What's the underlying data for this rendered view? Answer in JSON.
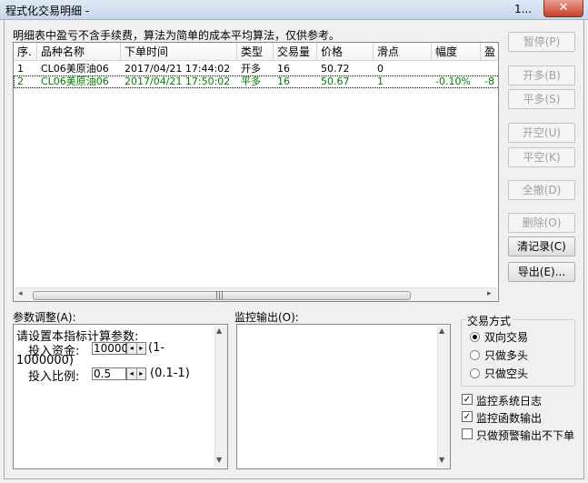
{
  "window": {
    "title": "程式化交易明细 - ",
    "title_suffix": "1...",
    "close": "✕"
  },
  "notice": "明细表中盈亏不含手续费，算法为简单的成本平均算法，仅供参考。",
  "table": {
    "columns": [
      "序.",
      "品种名称",
      "下单时间",
      "类型",
      "交易量",
      "价格",
      "滑点",
      "幅度",
      "盈"
    ],
    "rows": [
      {
        "idx": "1",
        "name": "CL06美原油06",
        "time": "2017/04/21 17:44:02",
        "type": "开多",
        "qty": "16",
        "price": "50.72",
        "slip": "0",
        "range": "",
        "pnl": ""
      },
      {
        "idx": "2",
        "name": "CL06美原油06",
        "time": "2017/04/21 17:50:02",
        "type": "平多",
        "qty": "16",
        "price": "50.67",
        "slip": "1",
        "range": "-0.10%",
        "pnl": "-8"
      }
    ],
    "row_colors": [
      "#000000",
      "#008000"
    ],
    "scroll": {
      "left": "◂",
      "right": "▸",
      "grip": "|||"
    }
  },
  "buttons": {
    "pause": "暂停(P)",
    "open_long": "开多(B)",
    "close_long": "平多(S)",
    "open_short": "开空(U)",
    "close_short": "平空(K)",
    "close_all": "全撤(D)",
    "delete": "删除(O)",
    "clear": "清记录(C)",
    "export": "导出(E)..."
  },
  "params": {
    "label": "参数调整(A):",
    "heading": "请设置本指标计算参数:",
    "fund_label": "投入资金:",
    "fund_value": "10000",
    "fund_range_a": "(1-",
    "fund_range_b": "1000000)",
    "ratio_label": "投入比例:",
    "ratio_value": "0.5",
    "ratio_range": "(0.1-1)",
    "spin_left": "◂",
    "spin_right": "▸",
    "scroll_up": "▲",
    "scroll_down": "▼"
  },
  "monitor": {
    "label": "监控输出(O):"
  },
  "trade_mode": {
    "title": "交易方式",
    "options": [
      "双向交易",
      "只做多头",
      "只做空头"
    ],
    "selected": 0
  },
  "checks": {
    "items": [
      "监控系统日志",
      "监控函数输出",
      "只做预警输出不下单"
    ],
    "checked": [
      true,
      true,
      false
    ],
    "mark": "✓"
  }
}
